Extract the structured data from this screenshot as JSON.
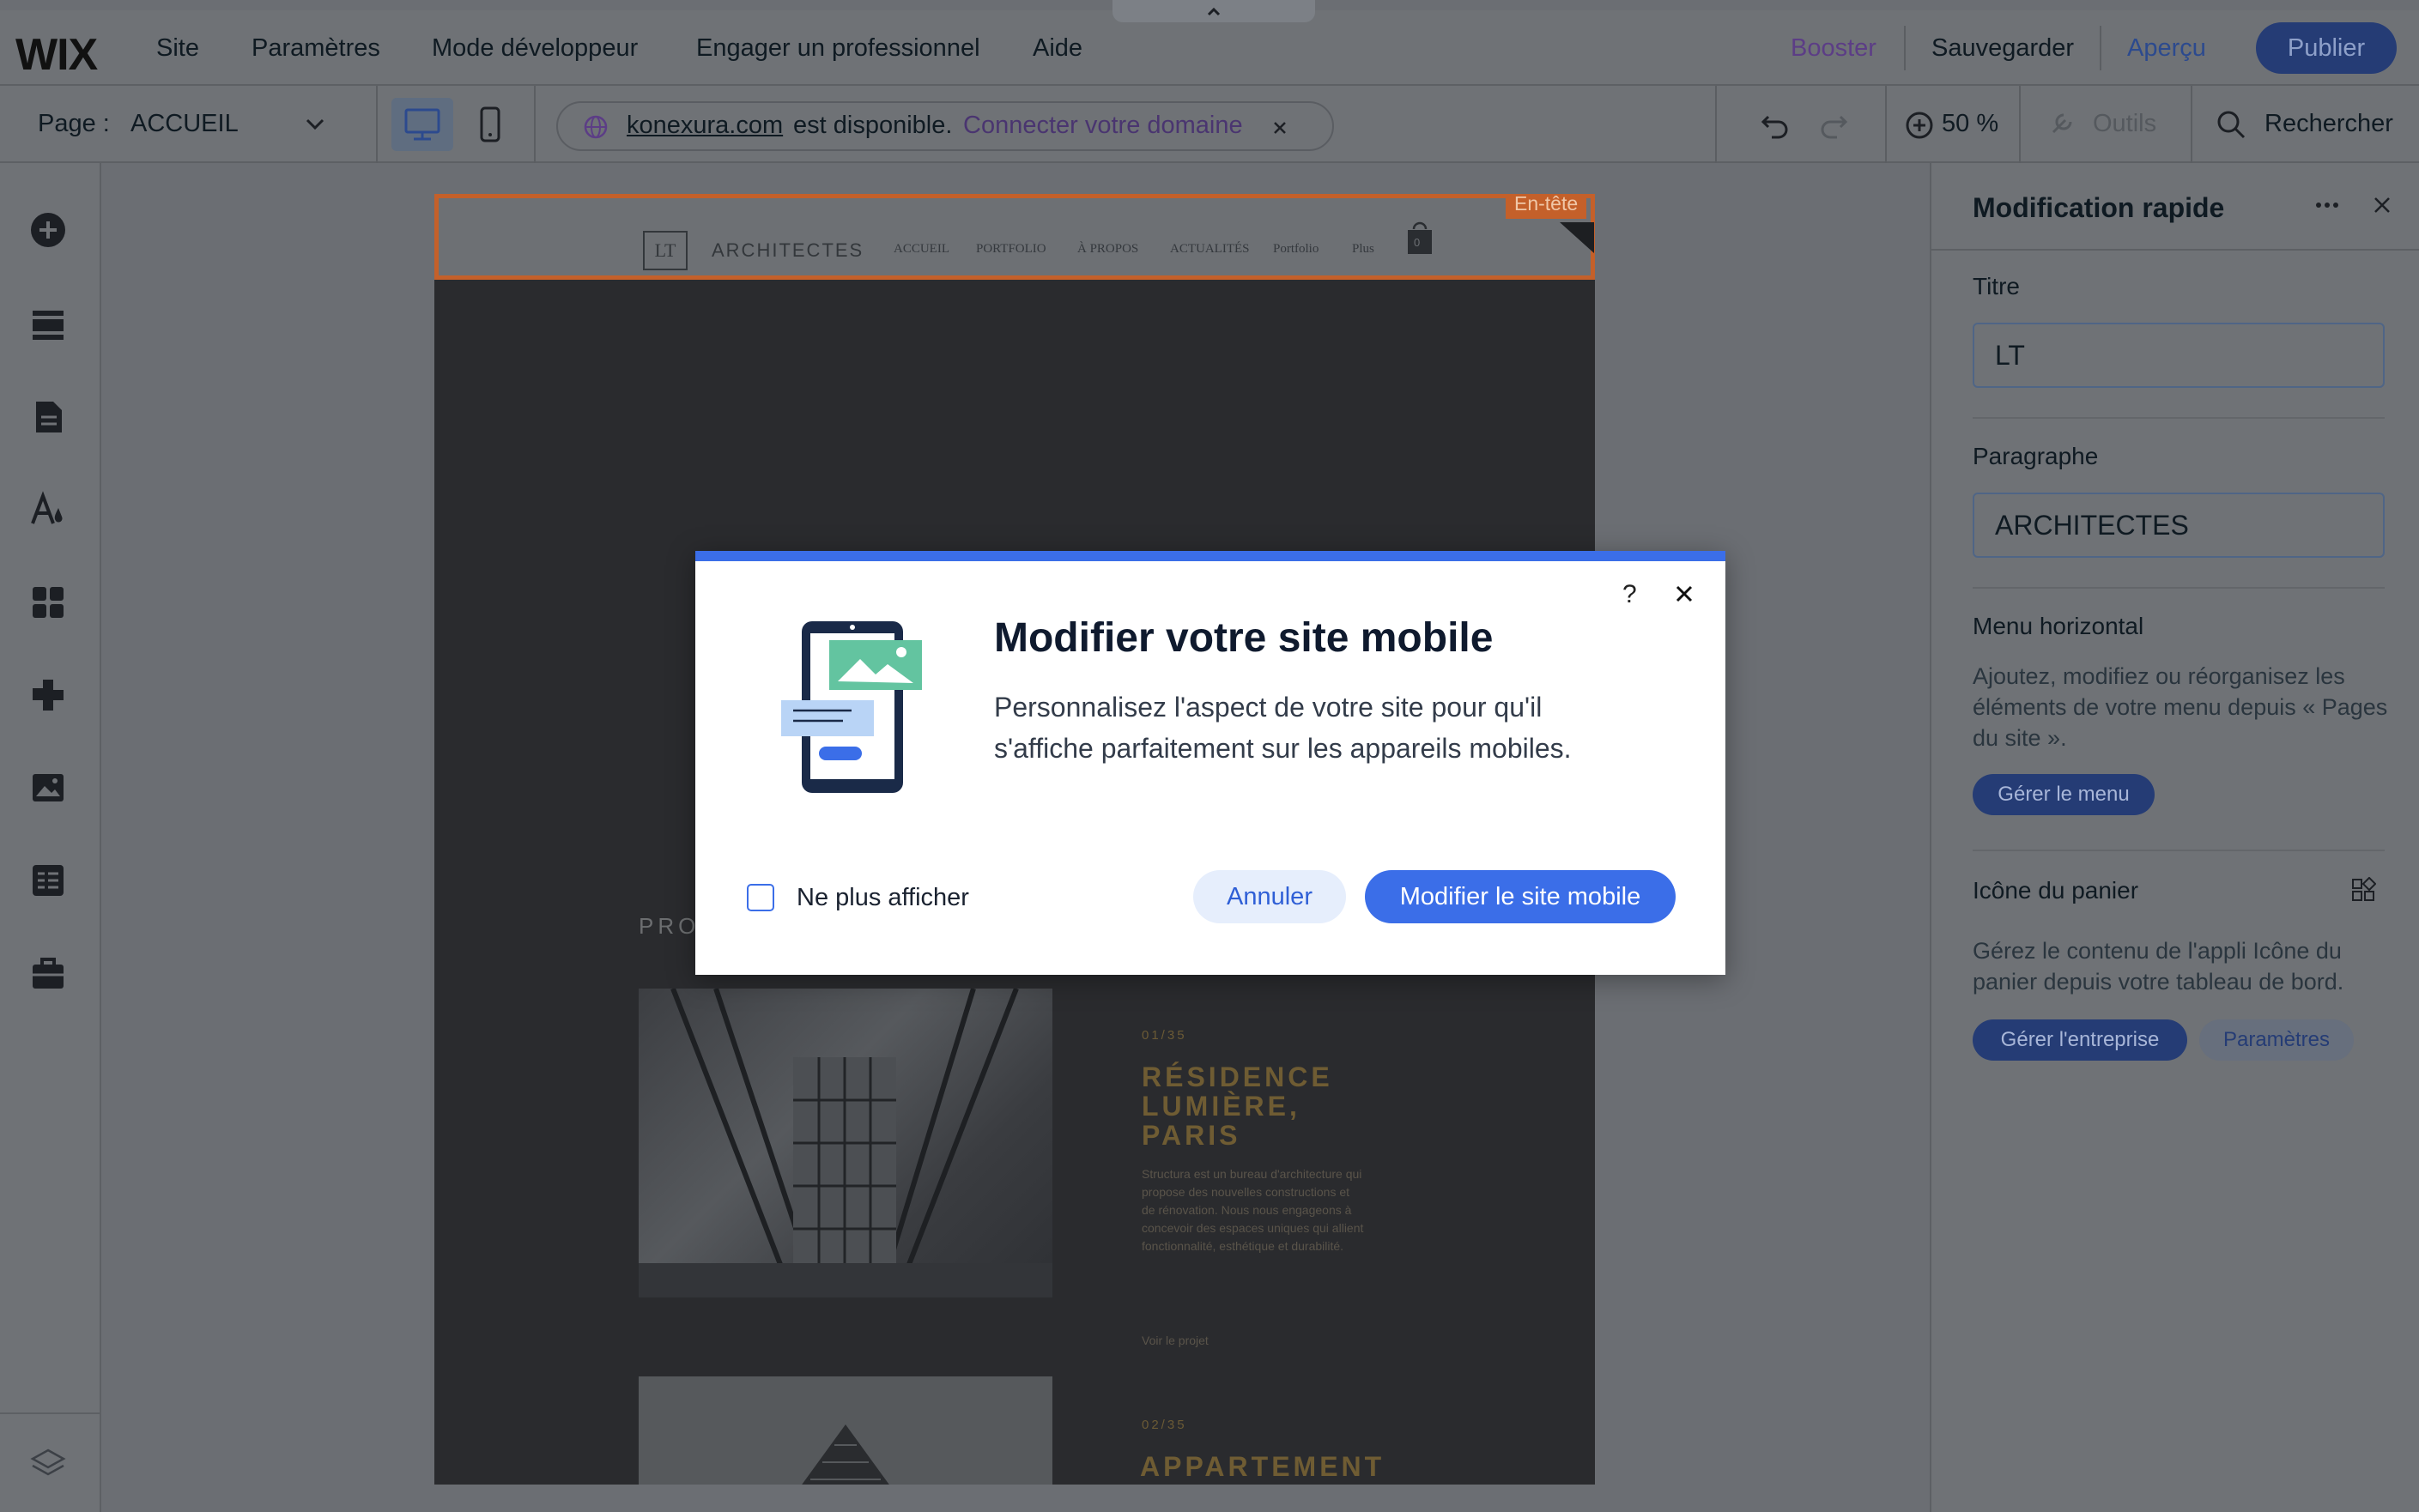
{
  "topbar": {
    "logo": "WIX",
    "menu": [
      "Site",
      "Paramètres",
      "Mode développeur",
      "Engager un professionnel",
      "Aide"
    ],
    "booster": "Booster",
    "save": "Sauvegarder",
    "preview": "Aperçu",
    "publish": "Publier"
  },
  "toolbar": {
    "page_label": "Page :",
    "page_value": "ACCUEIL",
    "domain": "konexura.com",
    "domain_status": "est disponible.",
    "connect_domain": "Connecter votre domaine",
    "zoom": "50 %",
    "tools": "Outils",
    "search": "Rechercher"
  },
  "site": {
    "header_tag": "En-tête",
    "logo_letters": "LT",
    "brand": "ARCHITECTES",
    "nav": [
      "ACCUEIL",
      "PORTFOLIO",
      "À PROPOS",
      "ACTUALITÉS",
      "Portfolio",
      "Plus"
    ],
    "cart_count": "0",
    "section_label": "PRO",
    "projects": [
      {
        "num": "01/35",
        "title_lines": [
          "RÉSIDENCE",
          "LUMIÈRE,",
          "PARIS"
        ],
        "desc": "Structura est un bureau d'architecture qui propose des nouvelles constructions et de rénovation. Nous nous engageons à concevoir des espaces uniques qui allient fonctionnalité, esthétique et durabilité.",
        "link": "Voir le projet"
      },
      {
        "num": "02/35",
        "title_lines": [
          "APPARTEMENT"
        ]
      }
    ]
  },
  "rightpanel": {
    "title": "Modification rapide",
    "title_label": "Titre",
    "title_value": "LT",
    "paragraph_label": "Paragraphe",
    "paragraph_value": "ARCHITECTES",
    "menu_label": "Menu horizontal",
    "menu_text": "Ajoutez, modifiez ou réorganisez les éléments de votre menu depuis « Pages du site ».",
    "menu_button": "Gérer le menu",
    "cart_label": "Icône du panier",
    "cart_text": "Gérez le contenu de l'appli Icône du panier depuis votre tableau de bord.",
    "cart_button_primary": "Gérer l'entreprise",
    "cart_button_secondary": "Paramètres"
  },
  "modal": {
    "title": "Modifier votre site mobile",
    "text": "Personnalisez l'aspect de votre site pour qu'il s'affiche parfaitement sur les appareils mobiles.",
    "help": "?",
    "checkbox_label": "Ne plus afficher",
    "cancel": "Annuler",
    "confirm": "Modifier le site mobile"
  },
  "colors": {
    "accent": "#3b6ee8",
    "publish": "#253c75",
    "header_outline": "#c4602a",
    "overlay": "#6f7276"
  }
}
